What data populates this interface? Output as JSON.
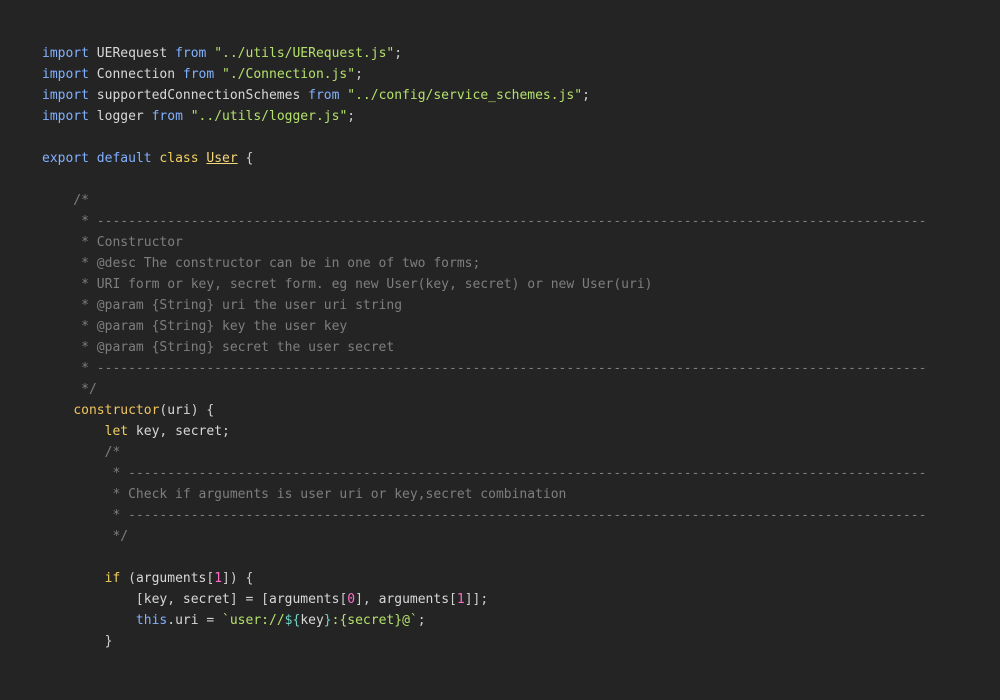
{
  "colors": {
    "background": "#242424",
    "keyword": "#82b1ff",
    "control": "#f0d05e",
    "identifier": "#d8d8d8",
    "string": "#b4e16b",
    "punctuation": "#cfcfcf",
    "comment": "#7e7e7e",
    "class_name": "#f5d77a",
    "function": "#f0c45e",
    "number": "#ff6bcb",
    "template": "#6fd3c5"
  },
  "lines": [
    [
      [
        "kw",
        "import"
      ],
      [
        "id",
        " UERequest "
      ],
      [
        "kw",
        "from"
      ],
      [
        "pun",
        " "
      ],
      [
        "str",
        "\"../utils/UERequest.js\""
      ],
      [
        "pun",
        ";"
      ]
    ],
    [
      [
        "kw",
        "import"
      ],
      [
        "id",
        " Connection "
      ],
      [
        "kw",
        "from"
      ],
      [
        "pun",
        " "
      ],
      [
        "str",
        "\"./Connection.js\""
      ],
      [
        "pun",
        ";"
      ]
    ],
    [
      [
        "kw",
        "import"
      ],
      [
        "id",
        " supportedConnectionSchemes "
      ],
      [
        "kw",
        "from"
      ],
      [
        "pun",
        " "
      ],
      [
        "str",
        "\"../config/service_schemes.js\""
      ],
      [
        "pun",
        ";"
      ]
    ],
    [
      [
        "kw",
        "import"
      ],
      [
        "id",
        " logger "
      ],
      [
        "kw",
        "from"
      ],
      [
        "pun",
        " "
      ],
      [
        "str",
        "\"../utils/logger.js\""
      ],
      [
        "pun",
        ";"
      ]
    ],
    [],
    [
      [
        "kw",
        "export"
      ],
      [
        "pun",
        " "
      ],
      [
        "kw",
        "default"
      ],
      [
        "pun",
        " "
      ],
      [
        "ctl",
        "class"
      ],
      [
        "pun",
        " "
      ],
      [
        "cls",
        "User"
      ],
      [
        "pun",
        " {"
      ]
    ],
    [],
    [
      [
        "cmt",
        "    /*"
      ]
    ],
    [
      [
        "cmt",
        "     * ----------------------------------------------------------------------------------------------------------"
      ]
    ],
    [
      [
        "cmt",
        "     * Constructor"
      ]
    ],
    [
      [
        "cmt",
        "     * @desc The constructor can be in one of two forms;"
      ]
    ],
    [
      [
        "cmt",
        "     * URI form or key, secret form. eg new User(key, secret) or new User(uri)"
      ]
    ],
    [
      [
        "cmt",
        "     * @param {String} uri the user uri string"
      ]
    ],
    [
      [
        "cmt",
        "     * @param {String} key the user key"
      ]
    ],
    [
      [
        "cmt",
        "     * @param {String} secret the user secret"
      ]
    ],
    [
      [
        "cmt",
        "     * ----------------------------------------------------------------------------------------------------------"
      ]
    ],
    [
      [
        "cmt",
        "     */"
      ]
    ],
    [
      [
        "pun",
        "    "
      ],
      [
        "fn",
        "constructor"
      ],
      [
        "pun",
        "("
      ],
      [
        "id",
        "uri"
      ],
      [
        "pun",
        ") {"
      ]
    ],
    [
      [
        "pun",
        "        "
      ],
      [
        "ctl",
        "let"
      ],
      [
        "id",
        " key"
      ],
      [
        "pun",
        ", "
      ],
      [
        "id",
        "secret"
      ],
      [
        "pun",
        ";"
      ]
    ],
    [
      [
        "cmt",
        "        /*"
      ]
    ],
    [
      [
        "cmt",
        "         * ------------------------------------------------------------------------------------------------------"
      ]
    ],
    [
      [
        "cmt",
        "         * Check if arguments is user uri or key,secret combination"
      ]
    ],
    [
      [
        "cmt",
        "         * ------------------------------------------------------------------------------------------------------"
      ]
    ],
    [
      [
        "cmt",
        "         */"
      ]
    ],
    [],
    [
      [
        "pun",
        "        "
      ],
      [
        "ctl",
        "if"
      ],
      [
        "pun",
        " ("
      ],
      [
        "id",
        "arguments"
      ],
      [
        "pun",
        "["
      ],
      [
        "num",
        "1"
      ],
      [
        "pun",
        "]) {"
      ]
    ],
    [
      [
        "pun",
        "            ["
      ],
      [
        "id",
        "key"
      ],
      [
        "pun",
        ", "
      ],
      [
        "id",
        "secret"
      ],
      [
        "pun",
        "] = ["
      ],
      [
        "id",
        "arguments"
      ],
      [
        "pun",
        "["
      ],
      [
        "num",
        "0"
      ],
      [
        "pun",
        "], "
      ],
      [
        "id",
        "arguments"
      ],
      [
        "pun",
        "["
      ],
      [
        "num",
        "1"
      ],
      [
        "pun",
        "]];"
      ]
    ],
    [
      [
        "pun",
        "            "
      ],
      [
        "kw",
        "this"
      ],
      [
        "pun",
        "."
      ],
      [
        "id",
        "uri"
      ],
      [
        "pun",
        " = "
      ],
      [
        "str",
        "`user://"
      ],
      [
        "tmpl",
        "${"
      ],
      [
        "id",
        "key"
      ],
      [
        "tmpl",
        "}"
      ],
      [
        "str",
        ":"
      ],
      [
        "str",
        "{secret}@`"
      ],
      [
        "pun",
        ";"
      ]
    ],
    [
      [
        "pun",
        "        }"
      ]
    ]
  ]
}
